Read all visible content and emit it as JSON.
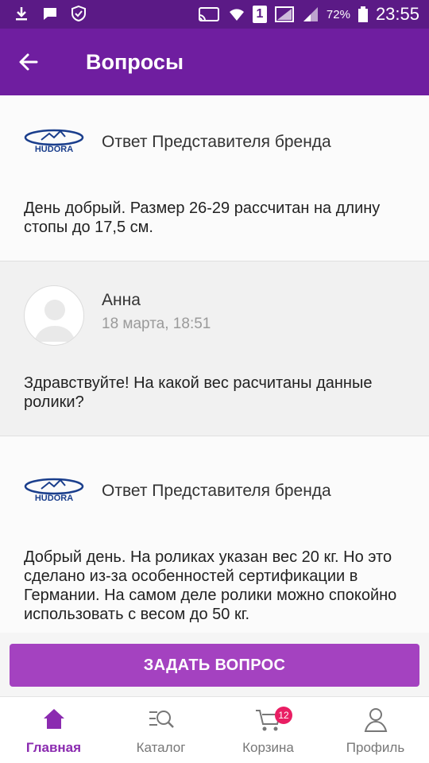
{
  "status_bar": {
    "battery": "72%",
    "time": "23:55",
    "sim_slot": "1"
  },
  "app_bar": {
    "title": "Вопросы"
  },
  "threads": [
    {
      "type": "brand",
      "author": "Ответ Представителя бренда",
      "logo_text": "HUDORA",
      "message": "День добрый. Размер 26-29 рассчитан на длину стопы до 17,5 см."
    },
    {
      "type": "user",
      "author": "Анна",
      "date": "18 марта, 18:51",
      "message": "Здравствуйте! На какой вес расчитаны данные ролики?"
    },
    {
      "type": "brand",
      "author": "Ответ Представителя бренда",
      "logo_text": "HUDORA",
      "message": "Добрый день. На роликах указан вес 20 кг. Но это сделано из-за особенностей сертификации в Германии. На самом деле ролики можно спокойно использовать с весом  до 50 кг."
    }
  ],
  "ask_button": "ЗАДАТЬ ВОПРОС",
  "bottom_nav": [
    {
      "label": "Главная",
      "icon": "home-icon",
      "active": true
    },
    {
      "label": "Каталог",
      "icon": "catalog-search-icon",
      "active": false
    },
    {
      "label": "Корзина",
      "icon": "cart-icon",
      "active": false,
      "badge": "12"
    },
    {
      "label": "Профиль",
      "icon": "profile-icon",
      "active": false
    }
  ],
  "colors": {
    "status_bar": "#5b1a86",
    "app_bar": "#6f1ea0",
    "accent": "#a442c0",
    "nav_active": "#8b2bb0",
    "badge": "#e91e63"
  }
}
